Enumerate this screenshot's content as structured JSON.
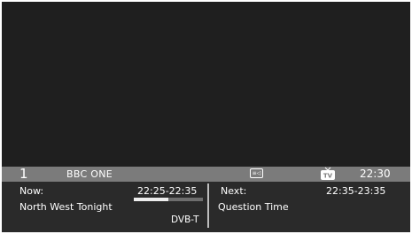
{
  "channel": {
    "number": "1",
    "name": "BBC ONE",
    "clock": "22:30",
    "subtitle_icon": "subtitle-icon",
    "tv_icon": "tv-icon",
    "tv_icon_text": "TV"
  },
  "now": {
    "label": "Now:",
    "time": "22:25-22:35",
    "programme": "North West Tonight",
    "broadcast": "DVB-T",
    "progress": 0.5
  },
  "next": {
    "label": "Next:",
    "time": "22:35-23:35",
    "programme": "Question Time"
  }
}
